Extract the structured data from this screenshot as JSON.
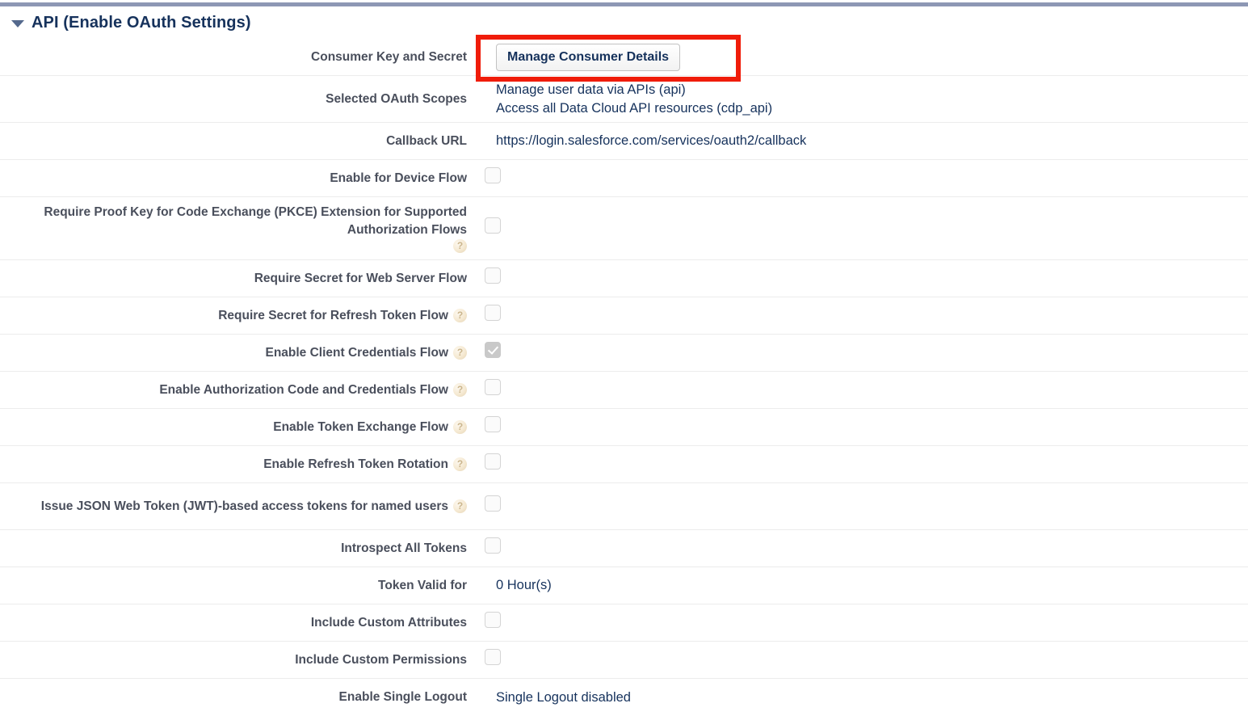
{
  "section": {
    "title": "API (Enable OAuth Settings)",
    "twisty_icon": "caret-down-icon",
    "expanded": true
  },
  "annotation": {
    "type": "red-rectangle-highlight",
    "color": "#f01c0a",
    "target": "Manage Consumer Details"
  },
  "fields": {
    "consumer_key_and_secret": {
      "label": "Consumer Key and Secret",
      "button_label": "Manage Consumer Details"
    },
    "selected_oauth_scopes": {
      "label": "Selected OAuth Scopes",
      "values": [
        "Manage user data via APIs (api)",
        "Access all Data Cloud API resources (cdp_api)"
      ]
    },
    "callback_url": {
      "label": "Callback URL",
      "value": "https://login.salesforce.com/services/oauth2/callback"
    },
    "enable_for_device_flow": {
      "label": "Enable for Device Flow",
      "checked": false,
      "has_help": false
    },
    "require_pkce": {
      "label": "Require Proof Key for Code Exchange (PKCE) Extension for Supported Authorization Flows",
      "checked": false,
      "has_help": true
    },
    "require_secret_web_server_flow": {
      "label": "Require Secret for Web Server Flow",
      "checked": false,
      "has_help": false
    },
    "require_secret_refresh_token_flow": {
      "label": "Require Secret for Refresh Token Flow",
      "checked": false,
      "has_help": true
    },
    "enable_client_credentials_flow": {
      "label": "Enable Client Credentials Flow",
      "checked": true,
      "has_help": true
    },
    "enable_authorization_code_and_credentials_flow": {
      "label": "Enable Authorization Code and Credentials Flow",
      "checked": false,
      "has_help": true
    },
    "enable_token_exchange_flow": {
      "label": "Enable Token Exchange Flow",
      "checked": false,
      "has_help": true
    },
    "enable_refresh_token_rotation": {
      "label": "Enable Refresh Token Rotation",
      "checked": false,
      "has_help": true
    },
    "issue_jwt_based_access_tokens": {
      "label": "Issue JSON Web Token (JWT)-based access tokens for named users",
      "checked": false,
      "has_help": true
    },
    "introspect_all_tokens": {
      "label": "Introspect All Tokens",
      "checked": false,
      "has_help": false
    },
    "token_valid_for": {
      "label": "Token Valid for",
      "value": "0 Hour(s)"
    },
    "include_custom_attributes": {
      "label": "Include Custom Attributes",
      "checked": false,
      "has_help": false
    },
    "include_custom_permissions": {
      "label": "Include Custom Permissions",
      "checked": false,
      "has_help": false
    },
    "enable_single_logout": {
      "label": "Enable Single Logout",
      "value": "Single Logout disabled"
    }
  },
  "help_icon_glyph": "?"
}
